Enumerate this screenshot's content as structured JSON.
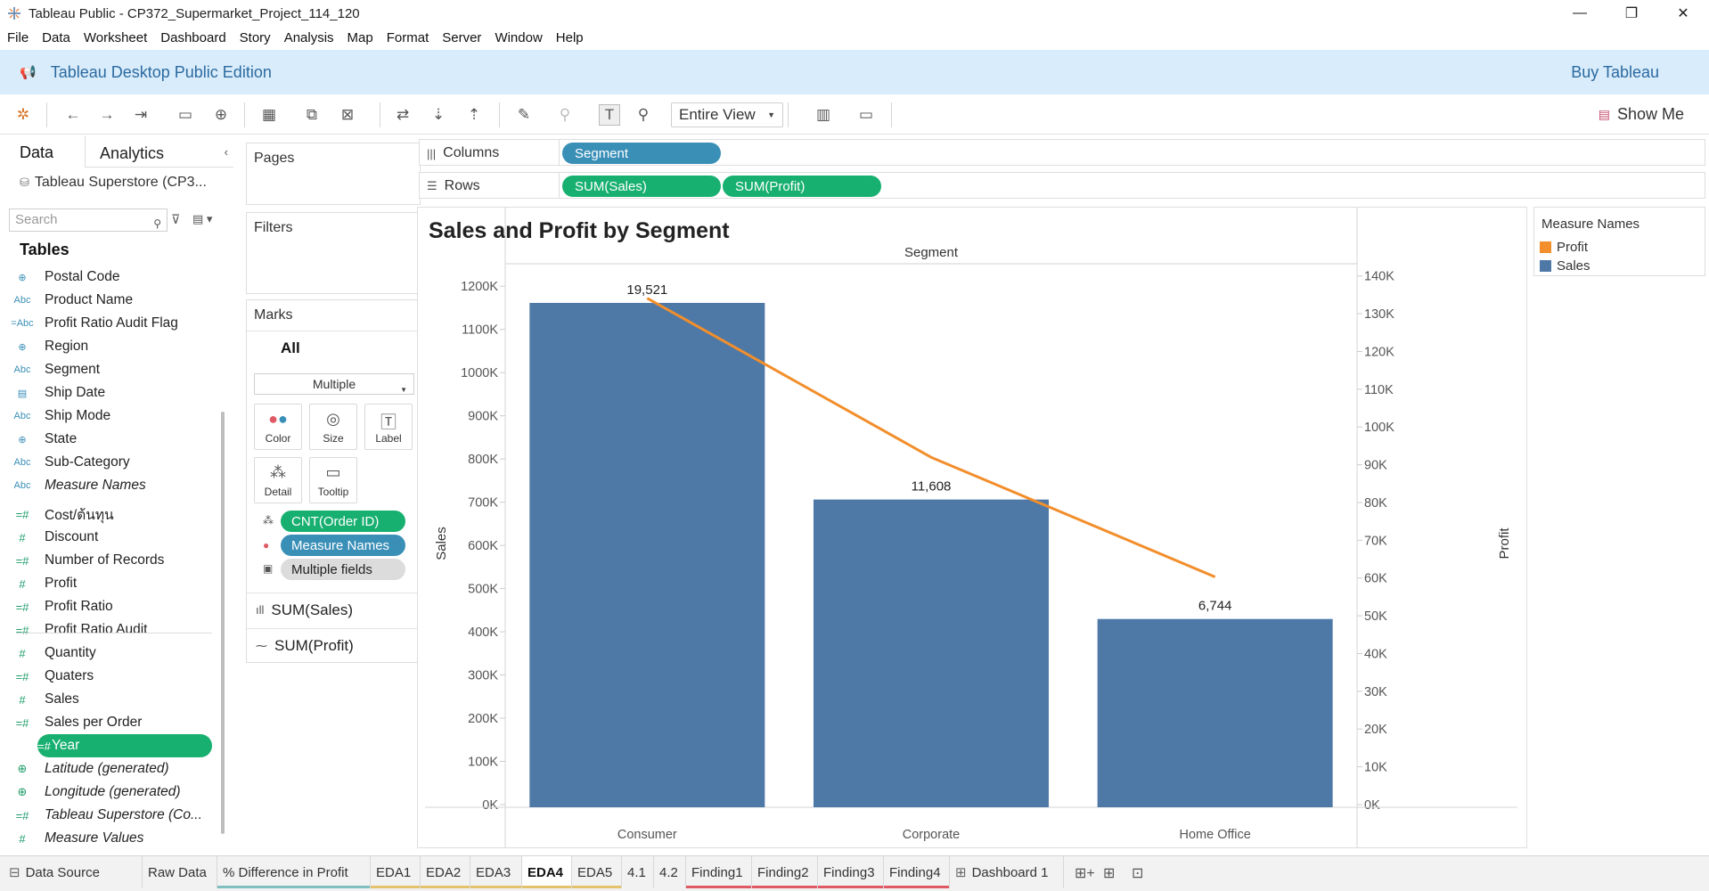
{
  "window": {
    "title": "Tableau Public - CP372_Supermarket_Project_114_120",
    "minimize": "—",
    "restore": "❐",
    "close": "✕"
  },
  "menu": [
    "File",
    "Data",
    "Worksheet",
    "Dashboard",
    "Story",
    "Analysis",
    "Map",
    "Format",
    "Server",
    "Window",
    "Help"
  ],
  "banner": {
    "edition": "Tableau Desktop Public Edition",
    "buy": "Buy Tableau"
  },
  "toolbar": {
    "fit": "Entire View",
    "show_me": "Show Me"
  },
  "data_pane": {
    "tab_data": "Data",
    "tab_analytics": "Analytics",
    "datasource": "Tableau Superstore (CP3...",
    "search_placeholder": "Search",
    "tables_header": "Tables",
    "fields": [
      {
        "label": "Postal Code",
        "icon": "⊕",
        "kind": "dim"
      },
      {
        "label": "Product Name",
        "icon": "Abc",
        "kind": "dim"
      },
      {
        "label": "Profit Ratio Audit Flag",
        "icon": "=Abc",
        "kind": "dim"
      },
      {
        "label": "Region",
        "icon": "⊕",
        "kind": "dim"
      },
      {
        "label": "Segment",
        "icon": "Abc",
        "kind": "dim"
      },
      {
        "label": "Ship Date",
        "icon": "▤",
        "kind": "dim"
      },
      {
        "label": "Ship Mode",
        "icon": "Abc",
        "kind": "dim"
      },
      {
        "label": "State",
        "icon": "⊕",
        "kind": "dim"
      },
      {
        "label": "Sub-Category",
        "icon": "Abc",
        "kind": "dim"
      },
      {
        "label": "Measure Names",
        "icon": "Abc",
        "kind": "dim",
        "italic": true
      },
      {
        "label": "Cost/ต้นทุน",
        "icon": "=#",
        "kind": "meas"
      },
      {
        "label": "Discount",
        "icon": "#",
        "kind": "meas"
      },
      {
        "label": "Number of Records",
        "icon": "=#",
        "kind": "meas"
      },
      {
        "label": "Profit",
        "icon": "#",
        "kind": "meas"
      },
      {
        "label": "Profit Ratio",
        "icon": "=#",
        "kind": "meas"
      },
      {
        "label": "Profit Ratio Audit",
        "icon": "=#",
        "kind": "meas"
      },
      {
        "label": "Quantity",
        "icon": "#",
        "kind": "meas"
      },
      {
        "label": "Quaters",
        "icon": "=#",
        "kind": "meas"
      },
      {
        "label": "Sales",
        "icon": "#",
        "kind": "meas"
      },
      {
        "label": "Sales per Order",
        "icon": "=#",
        "kind": "meas"
      },
      {
        "label": "Year",
        "icon": "=#",
        "kind": "meas",
        "selected": true
      },
      {
        "label": "Latitude (generated)",
        "icon": "⊕",
        "kind": "meas",
        "italic": true
      },
      {
        "label": "Longitude (generated)",
        "icon": "⊕",
        "kind": "meas",
        "italic": true
      },
      {
        "label": "Tableau Superstore (Co...",
        "icon": "=#",
        "kind": "meas",
        "italic": true
      },
      {
        "label": "Measure Values",
        "icon": "#",
        "kind": "meas",
        "italic": true
      }
    ]
  },
  "cards": {
    "pages": "Pages",
    "filters": "Filters",
    "marks": "Marks",
    "marks_all": "All",
    "marks_type": "Multiple",
    "buttons": [
      "Color",
      "Size",
      "Label",
      "Detail",
      "Tooltip"
    ],
    "pills": [
      "CNT(Order ID)",
      "Measure Names",
      "Multiple fields"
    ],
    "measures": [
      "SUM(Sales)",
      "SUM(Profit)"
    ]
  },
  "shelves": {
    "columns_label": "Columns",
    "rows_label": "Rows",
    "columns": [
      "Segment"
    ],
    "rows": [
      "SUM(Sales)",
      "SUM(Profit)"
    ]
  },
  "legend": {
    "title": "Measure Names",
    "items": [
      {
        "label": "Profit",
        "color": "#f28e2b"
      },
      {
        "label": "Sales",
        "color": "#4e79a7"
      }
    ]
  },
  "chart_data": {
    "type": "bar",
    "title": "Sales and Profit by Segment",
    "header": "Segment",
    "categories": [
      "Consumer",
      "Corporate",
      "Home Office"
    ],
    "series": [
      {
        "name": "Sales",
        "type": "bar",
        "axis": "left",
        "color": "#4e79a7",
        "values": [
          1161400,
          706146,
          429653
        ]
      },
      {
        "name": "Profit",
        "type": "line",
        "axis": "right",
        "color": "#f28e2b",
        "values": [
          134119,
          91979,
          60299
        ]
      }
    ],
    "labels": [
      "19,521",
      "11,608",
      "6,744"
    ],
    "ylabel": "Sales",
    "y2label": "Profit",
    "ylim": [
      0,
      1250000
    ],
    "y2lim": [
      0,
      143000
    ],
    "yticks": [
      "0K",
      "100K",
      "200K",
      "300K",
      "400K",
      "500K",
      "600K",
      "700K",
      "800K",
      "900K",
      "1000K",
      "1100K",
      "1200K"
    ],
    "y2ticks": [
      "0K",
      "10K",
      "20K",
      "30K",
      "40K",
      "50K",
      "60K",
      "70K",
      "80K",
      "90K",
      "100K",
      "110K",
      "120K",
      "130K",
      "140K"
    ]
  },
  "sheet_tabs": [
    {
      "label": "Data Source",
      "icon": "⊟"
    },
    {
      "label": "Raw Data"
    },
    {
      "label": "% Difference in Profit",
      "color": "#7fbfbf"
    },
    {
      "label": "EDA1",
      "color": "#e3c26b"
    },
    {
      "label": "EDA2",
      "color": "#e3c26b"
    },
    {
      "label": "EDA3",
      "color": "#e3c26b"
    },
    {
      "label": "EDA4",
      "color": "#e3c26b",
      "active": true
    },
    {
      "label": "EDA5",
      "color": "#e3c26b"
    },
    {
      "label": "4.1"
    },
    {
      "label": "4.2"
    },
    {
      "label": "Finding1",
      "color": "#e05a66"
    },
    {
      "label": "Finding2",
      "color": "#e05a66"
    },
    {
      "label": "Finding3",
      "color": "#e05a66"
    },
    {
      "label": "Finding4",
      "color": "#e05a66"
    },
    {
      "label": "Dashboard 1",
      "icon": "⊞"
    }
  ]
}
